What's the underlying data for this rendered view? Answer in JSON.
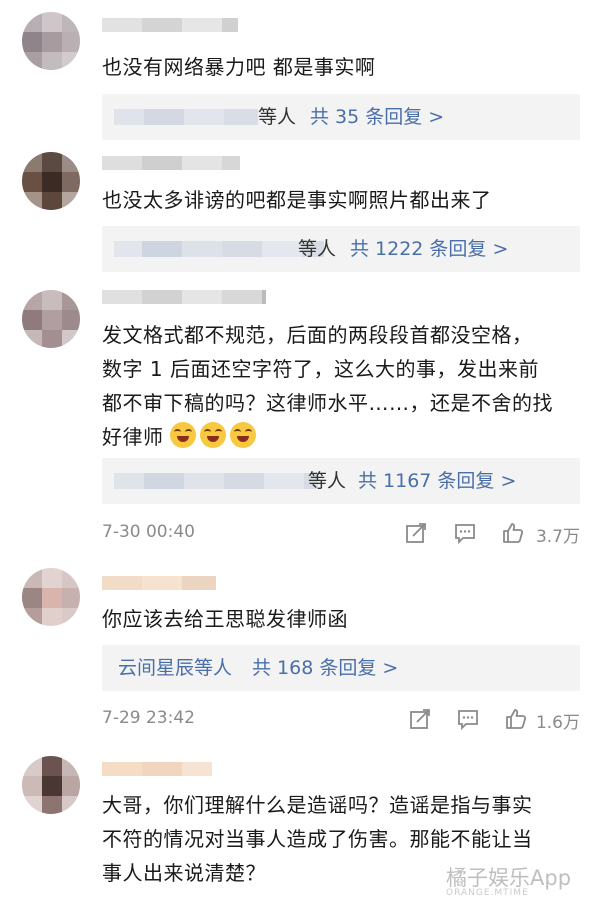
{
  "comments": [
    {
      "text": "也没有网络暴力吧 都是事实啊",
      "replies": {
        "who_suffix": "等人",
        "count": "共 35 条回复 >"
      }
    },
    {
      "text": "也没太多诽谤的吧都是事实啊照片都出来了",
      "replies": {
        "who_suffix": "等人",
        "count": "共 1222 条回复 >"
      }
    },
    {
      "text_lines": [
        "发文格式都不规范，后面的两段段首都没空格，",
        "数字 1 后面还空字符了，这么大的事，发出来前",
        "都不审下稿的吗？这律师水平……，还是不舍的找",
        "好律师"
      ],
      "emoji": [
        "laughing-crying-emoji",
        "laughing-crying-emoji",
        "laughing-crying-emoji"
      ],
      "replies": {
        "who_suffix": "等人",
        "count": "共 1167 条回复 >"
      },
      "time": "7-30 00:40",
      "likes": "3.7万"
    },
    {
      "text": "你应该去给王思聪发律师函",
      "replies": {
        "who": "云间星辰等人",
        "count": "共 168 条回复 >"
      },
      "time": "7-29 23:42",
      "likes": "1.6万"
    },
    {
      "text_lines": [
        "大哥，你们理解什么是造谣吗？造谣是指与事实",
        "不符的情况对当事人造成了伤害。那能不能让当",
        "事人出来说清楚？"
      ]
    }
  ],
  "watermark": {
    "title": "橘子娱乐App",
    "sub": "ORANGE.MTIME"
  },
  "colors": {
    "link": "#4a6fa8",
    "reply_bg": "#f3f3f3",
    "meta": "#8a8a8a"
  }
}
